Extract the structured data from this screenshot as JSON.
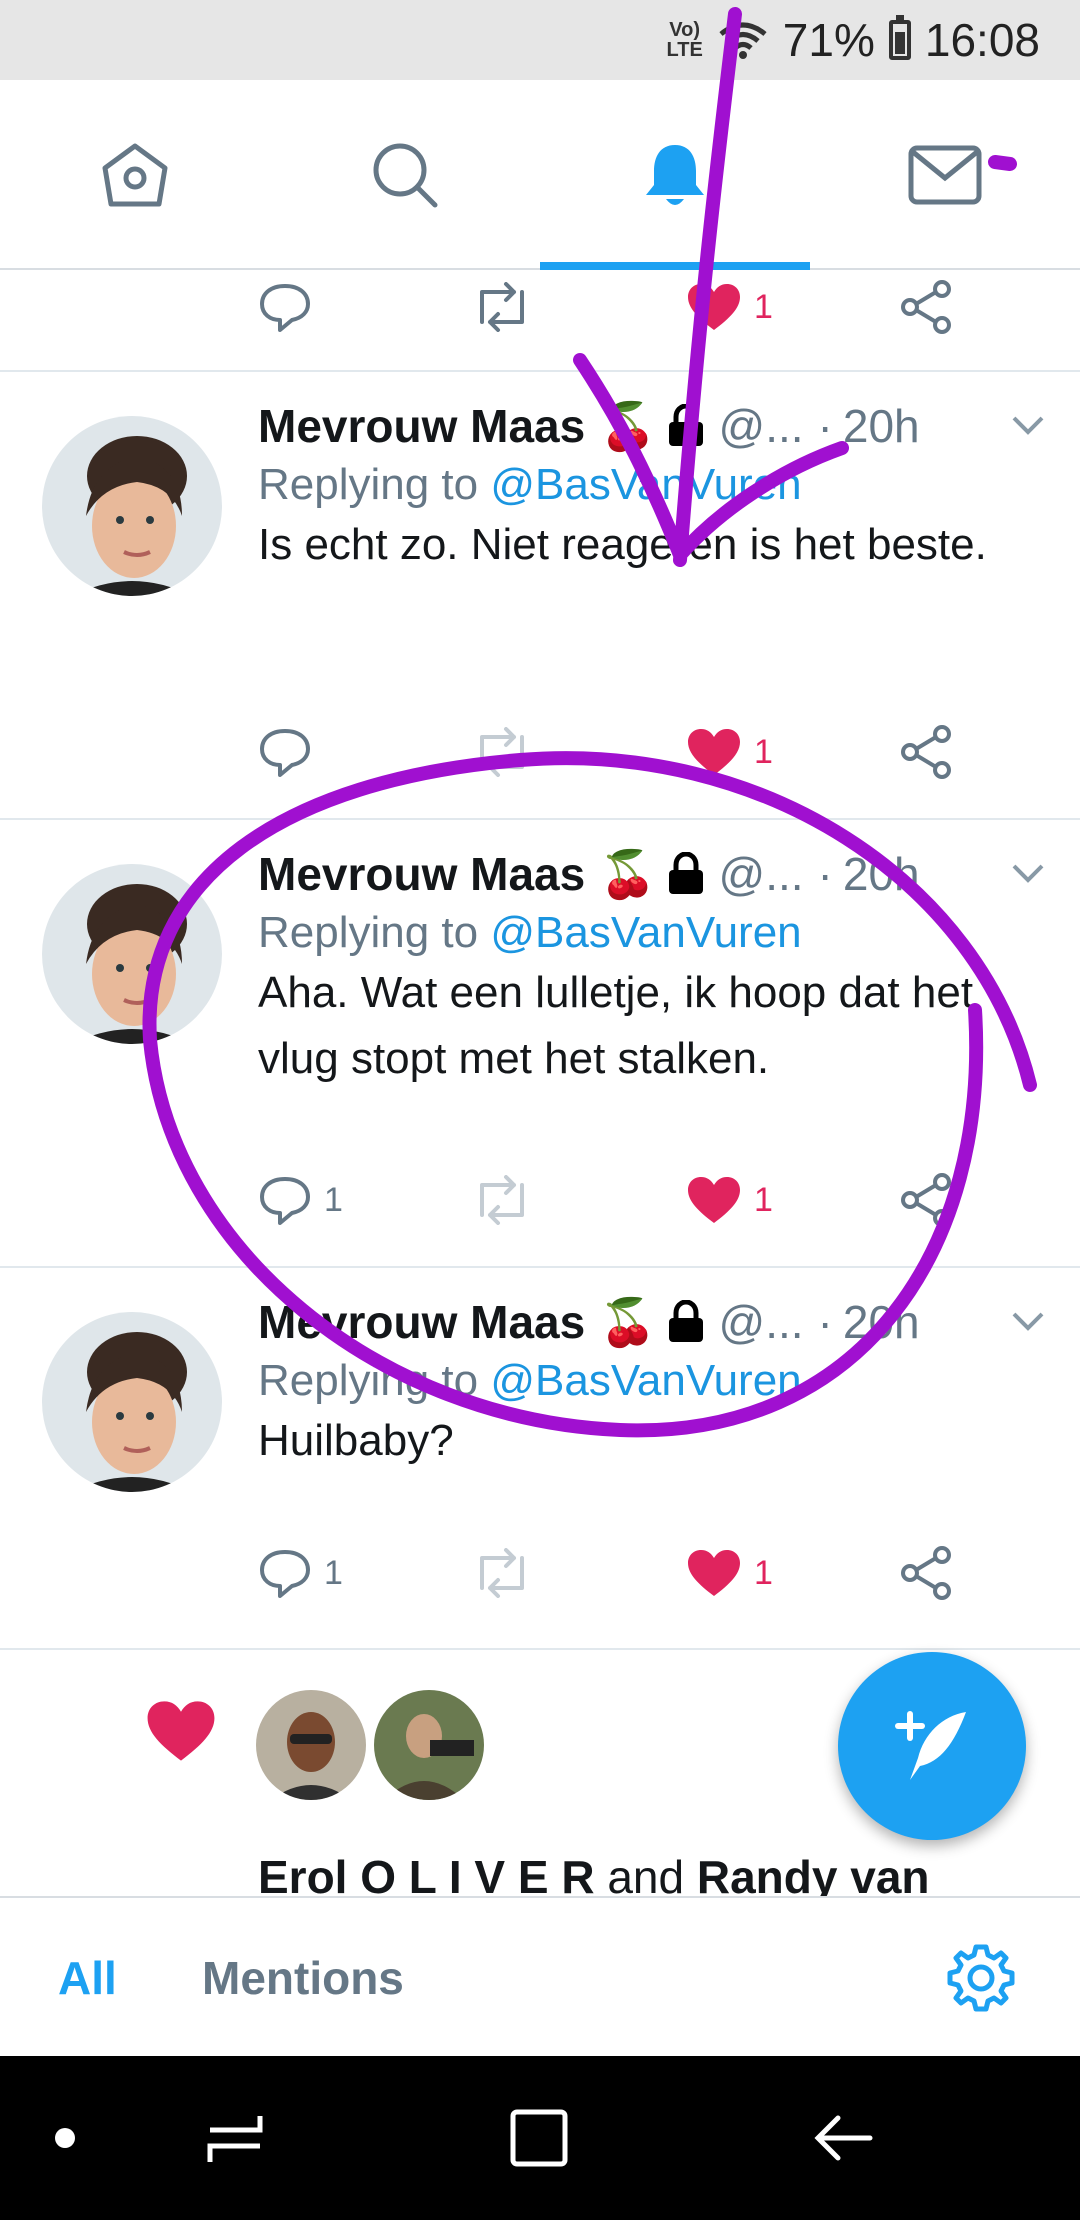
{
  "status_bar": {
    "network": "LTE",
    "battery": "71%",
    "time": "16:08"
  },
  "top_nav": {
    "tabs": [
      {
        "name": "home",
        "icon": "home-icon"
      },
      {
        "name": "search",
        "icon": "search-icon"
      },
      {
        "name": "notifications",
        "icon": "bell-icon",
        "active": true
      },
      {
        "name": "messages",
        "icon": "envelope-icon",
        "badge": true
      }
    ]
  },
  "partial_tweet": {
    "like_count": "1"
  },
  "tweets": [
    {
      "name": "Mevrouw Maas",
      "emoji": "🍒",
      "handle": "@...",
      "dot": "·",
      "time": "20h",
      "replying_prefix": "Replying to ",
      "replying_handle": "@BasVanVuren",
      "text": "Is echt zo. Niet reageren is het beste.",
      "reply_count": "",
      "like_count": "1"
    },
    {
      "name": "Mevrouw Maas",
      "emoji": "🍒",
      "handle": "@...",
      "dot": "·",
      "time": "20h",
      "replying_prefix": "Replying to ",
      "replying_handle": "@BasVanVuren",
      "text": "Aha. Wat een lulletje, ik hoop dat het vlug stopt met het stalken.",
      "reply_count": "1",
      "like_count": "1"
    },
    {
      "name": "Mevrouw Maas",
      "emoji": "🍒",
      "handle": "@...",
      "dot": "·",
      "time": "20h",
      "replying_prefix": "Replying to ",
      "replying_handle": "@BasVanVuren",
      "text": "Huilbaby?",
      "reply_count": "1",
      "like_count": "1"
    }
  ],
  "like_notification": {
    "user1": "Erol O L I V E R",
    "connector": " and ",
    "user2": "Randy van"
  },
  "bottom_tabs": {
    "all": "All",
    "mentions": "Mentions"
  },
  "colors": {
    "accent": "#1da1f2",
    "like": "#e0245e",
    "annotation": "#a010d0"
  }
}
